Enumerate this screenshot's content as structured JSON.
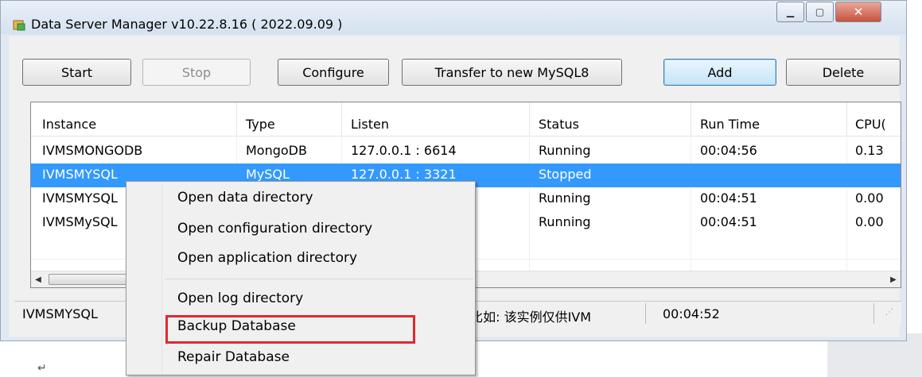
{
  "window": {
    "title": "Data Server Manager v10.22.8.16 ( 2022.09.09 )"
  },
  "toolbar": {
    "start": "Start",
    "stop": "Stop",
    "configure": "Configure",
    "transfer": "Transfer to new MySQL8",
    "add": "Add",
    "delete": "Delete"
  },
  "table": {
    "headers": [
      "Instance",
      "Type",
      "Listen",
      "Status",
      "Run Time",
      "CPU("
    ],
    "rows": [
      [
        "IVMSMONGODB",
        "MongoDB",
        "127.0.0.1 : 6614",
        "Running",
        "00:04:56",
        "0.13"
      ],
      [
        "IVMSMYSQL",
        "MySQL",
        "127.0.0.1 : 3321",
        "Stopped",
        "",
        ""
      ],
      [
        "IVMSMYSQL",
        "",
        "",
        "Running",
        "00:04:51",
        "0.00"
      ],
      [
        "IVMSMySQL",
        "",
        "",
        "Running",
        "00:04:51",
        "0.00"
      ]
    ],
    "selected_row": 1
  },
  "statusbar": {
    "instance": "IVMSMYSQL",
    "description": ",比如: 该实例仅供IVM",
    "time": "00:04:52"
  },
  "context_menu": {
    "items": [
      "Open data directory",
      "Open configuration directory",
      "Open application directory",
      "Open log directory",
      "Backup Database",
      "Repair Database"
    ],
    "highlighted_item": "Backup Database",
    "highlight_color": "#e0292e"
  },
  "colors": {
    "selection": "#3399ff"
  },
  "doc": {
    "paragraph_mark": "↵"
  }
}
